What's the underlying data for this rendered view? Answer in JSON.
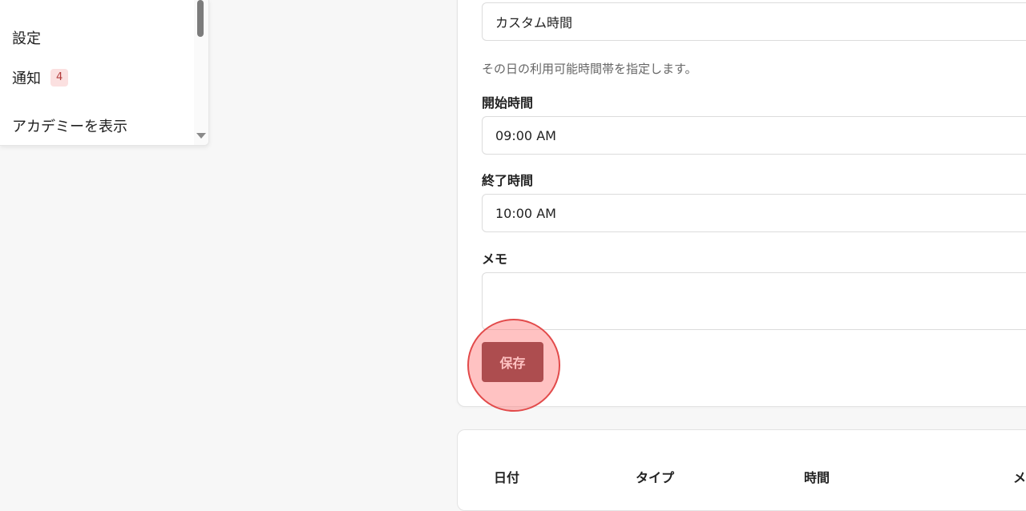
{
  "sidebar": {
    "items": [
      {
        "label": "設定"
      },
      {
        "label": "通知",
        "badge": "4"
      },
      {
        "label": "アカデミーを表示"
      }
    ]
  },
  "form": {
    "time_type_value": "カスタム時間",
    "help_text": "その日の利用可能時間帯を指定します。",
    "start_label": "開始時間",
    "start_value": "09:00 AM",
    "end_label": "終了時間",
    "end_value": "10:00 AM",
    "memo_label": "メモ",
    "memo_value": "",
    "save_label": "保存"
  },
  "table": {
    "headers": [
      "日付",
      "タイプ",
      "時間",
      "メ"
    ]
  },
  "colors": {
    "accent": "#6b2b2e",
    "badge_bg": "#fbe0e0",
    "badge_text": "#b23b3b",
    "highlight": "#e24a4a"
  }
}
